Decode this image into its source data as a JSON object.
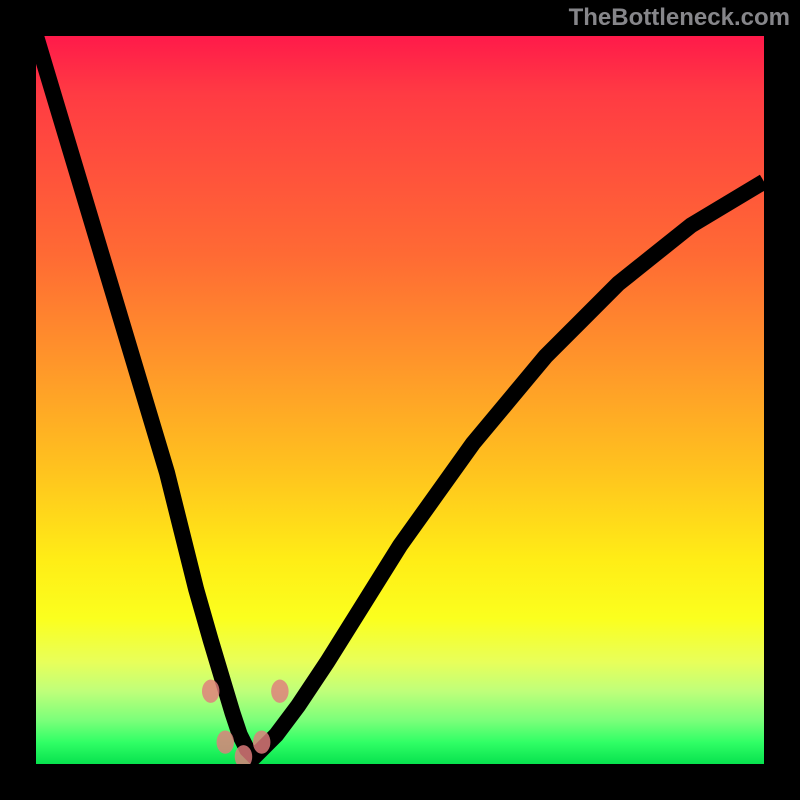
{
  "watermark": "TheBottleneck.com",
  "chart_data": {
    "type": "line",
    "title": "",
    "xlabel": "",
    "ylabel": "",
    "xlim": [
      0,
      100
    ],
    "ylim": [
      0,
      100
    ],
    "gradient_stops": [
      {
        "pos": 0,
        "color": "#ff1a4a"
      },
      {
        "pos": 30,
        "color": "#ff6a34"
      },
      {
        "pos": 60,
        "color": "#ffc41e"
      },
      {
        "pos": 80,
        "color": "#fbff1e"
      },
      {
        "pos": 94,
        "color": "#7bff7a"
      },
      {
        "pos": 100,
        "color": "#07e24e"
      }
    ],
    "series": [
      {
        "name": "curve",
        "x": [
          0,
          3,
          6,
          9,
          12,
          15,
          18,
          20,
          22,
          24,
          25.5,
          27,
          28,
          29,
          30,
          31,
          33,
          36,
          40,
          45,
          50,
          55,
          60,
          65,
          70,
          75,
          80,
          85,
          90,
          95,
          100
        ],
        "y": [
          100,
          90,
          80,
          70,
          60,
          50,
          40,
          32,
          24,
          17,
          12,
          7,
          4,
          2,
          1,
          2,
          4,
          8,
          14,
          22,
          30,
          37,
          44,
          50,
          56,
          61,
          66,
          70,
          74,
          77,
          80
        ]
      }
    ],
    "marker_points": [
      {
        "x": 24.0,
        "y": 10
      },
      {
        "x": 26.0,
        "y": 3
      },
      {
        "x": 28.5,
        "y": 1
      },
      {
        "x": 31.0,
        "y": 3
      },
      {
        "x": 33.5,
        "y": 10
      }
    ]
  }
}
